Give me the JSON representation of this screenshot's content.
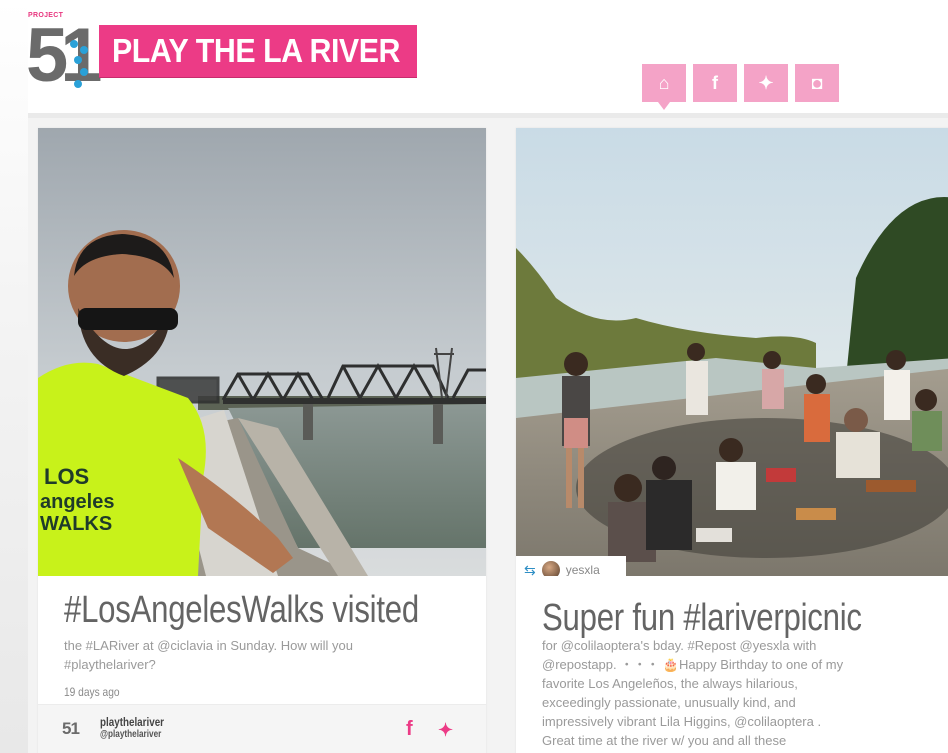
{
  "header": {
    "logo_project": "PROJECT",
    "logo_number": "51",
    "title": "PLAY THE LA RIVER",
    "nav": [
      {
        "icon": "home-icon",
        "glyph": "⌂"
      },
      {
        "icon": "facebook-icon",
        "glyph": "f"
      },
      {
        "icon": "twitter-icon",
        "glyph": "✦"
      },
      {
        "icon": "instagram-icon",
        "glyph": "◘"
      }
    ]
  },
  "colors": {
    "brand_pink": "#ec3b86",
    "nav_pink": "#f4a3c7",
    "logo_gray": "#6b6b6b",
    "logo_blue": "#2aa1d8"
  },
  "cards": [
    {
      "headline": "#LosAngelesWalks visited",
      "caption_lines": [
        "the #LARiver at @ciclavia in Sunday. How will you",
        "#playthelariver?"
      ],
      "time_ago": "19 days ago",
      "author_logo": "51",
      "author_name": "playthelariver",
      "author_handle": "@playthelariver",
      "shirt_text": [
        "LOS",
        "angeles",
        "WALKS"
      ],
      "share": [
        "facebook-icon",
        "twitter-icon"
      ]
    },
    {
      "headline": "Super fun #lariverpicnic",
      "repost_user": "yesxla",
      "caption_lines": [
        "for @colilaoptera's bday. #Repost @yesxla with",
        "@repostapp. ・・・ 🎂Happy Birthday to one of my",
        "favorite Los Angeleños, the always hilarious,",
        "exceedingly passionate, unusually kind, and",
        "impressively vibrant Lila Higgins, @colilaoptera .",
        "Great time at the river w/ you and all these"
      ]
    }
  ]
}
